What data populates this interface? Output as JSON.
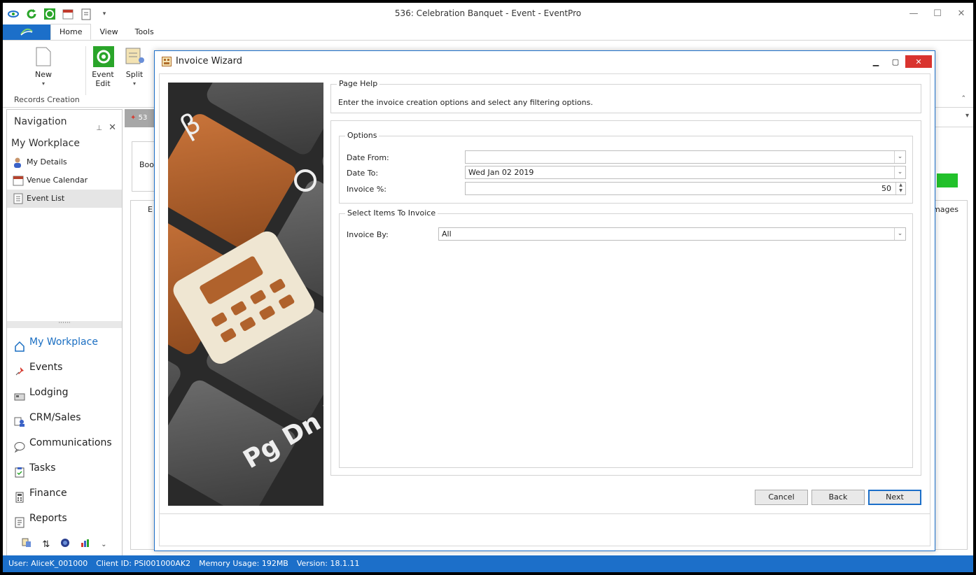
{
  "window": {
    "title": "536: Celebration Banquet - Event - EventPro"
  },
  "ribbon": {
    "tabs": [
      {
        "label": "Home"
      },
      {
        "label": "View"
      },
      {
        "label": "Tools"
      }
    ],
    "buttons": {
      "new": "New",
      "event_edit_1": "Event",
      "event_edit_2": "Edit",
      "split": "Split"
    },
    "group_label": "Records Creation"
  },
  "navigation": {
    "title": "Navigation",
    "workplace_title": "My Workplace",
    "items": [
      {
        "label": "My Details"
      },
      {
        "label": "Venue Calendar"
      },
      {
        "label": "Event List"
      }
    ],
    "modules": [
      {
        "label": "My Workplace"
      },
      {
        "label": "Events"
      },
      {
        "label": "Lodging"
      },
      {
        "label": "CRM/Sales"
      },
      {
        "label": "Communications"
      },
      {
        "label": "Tasks"
      },
      {
        "label": "Finance"
      },
      {
        "label": "Reports"
      }
    ]
  },
  "background": {
    "doc_tab": "53",
    "book_label": "Book",
    "tab_e": "E",
    "images_label": "mages"
  },
  "dialog": {
    "title": "Invoice Wizard",
    "page_help": {
      "legend": "Page Help",
      "text": "Enter the invoice creation options and select any filtering options."
    },
    "options": {
      "legend": "Options",
      "date_from_label": "Date From:",
      "date_from_value": "",
      "date_to_label": "Date To:",
      "date_to_value": "Wed Jan 02 2019",
      "invoice_pct_label": "Invoice %:",
      "invoice_pct_value": "50"
    },
    "select_items": {
      "legend": "Select Items To Invoice",
      "invoice_by_label": "Invoice By:",
      "invoice_by_value": "All"
    },
    "buttons": {
      "cancel": "Cancel",
      "back": "Back",
      "next": "Next"
    }
  },
  "status": {
    "user": "User: AliceK_001000",
    "client": "Client ID: PSI001000AK2",
    "memory": "Memory Usage: 192MB",
    "version": "Version: 18.1.11"
  },
  "colors": {
    "accent": "#1c6fc9",
    "close_red": "#d9342f",
    "green": "#22c12b",
    "key_orange": "#b0622c"
  }
}
